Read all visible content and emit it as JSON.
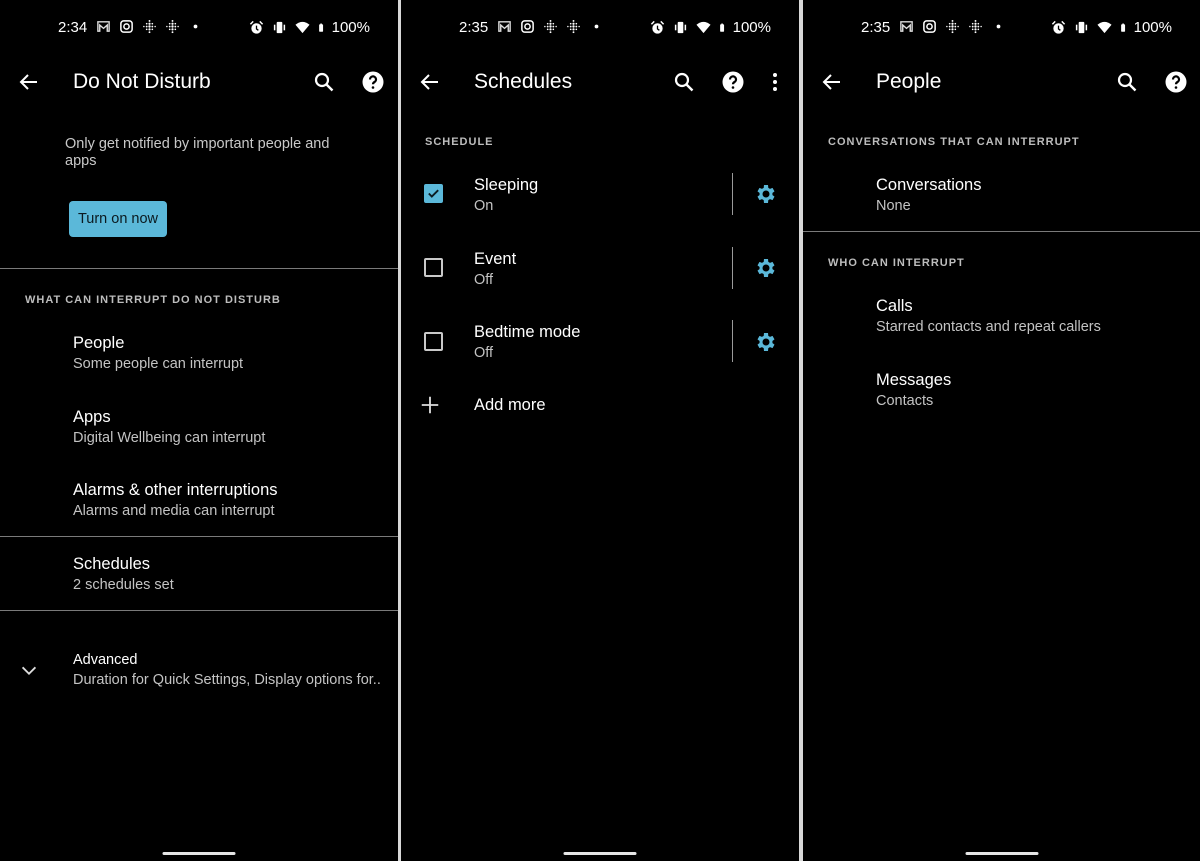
{
  "accent_color": "#5bb8d9",
  "status_bar_common": {
    "battery": "100%",
    "left_icons": [
      "gmail-icon",
      "instagram-icon",
      "fitbit-icon",
      "fitbit-icon",
      "dot-icon"
    ],
    "right_icons": [
      "alarm-icon",
      "vibrate-icon",
      "wifi-icon",
      "battery-icon"
    ]
  },
  "panels": [
    {
      "status_time": "2:34",
      "title": "Do Not Disturb",
      "toolbar_icons": [
        "search-icon",
        "help-icon"
      ],
      "description": "Only get notified by important people and apps",
      "primary_button": "Turn on now",
      "section_header": "WHAT CAN INTERRUPT DO NOT DISTURB",
      "items": [
        {
          "title": "People",
          "subtitle": "Some people can interrupt"
        },
        {
          "title": "Apps",
          "subtitle": "Digital Wellbeing can interrupt"
        },
        {
          "title": "Alarms & other interruptions",
          "subtitle": "Alarms and media can interrupt"
        },
        {
          "title": "Schedules",
          "subtitle": "2 schedules set"
        },
        {
          "title": "Advanced",
          "subtitle": "Duration for Quick Settings, Display options for.."
        }
      ]
    },
    {
      "status_time": "2:35",
      "title": "Schedules",
      "toolbar_icons": [
        "search-icon",
        "help-icon",
        "more-vert-icon"
      ],
      "section_header": "SCHEDULE",
      "schedules": [
        {
          "title": "Sleeping",
          "status": "On",
          "enabled": true
        },
        {
          "title": "Event",
          "status": "Off",
          "enabled": false
        },
        {
          "title": "Bedtime mode",
          "status": "Off",
          "enabled": false
        }
      ],
      "add_more": "Add more"
    },
    {
      "status_time": "2:35",
      "title": "People",
      "toolbar_icons": [
        "search-icon",
        "help-icon"
      ],
      "section1_header": "CONVERSATIONS THAT CAN INTERRUPT",
      "conversations": {
        "title": "Conversations",
        "subtitle": "None"
      },
      "section2_header": "WHO CAN INTERRUPT",
      "items": [
        {
          "title": "Calls",
          "subtitle": "Starred contacts and repeat callers"
        },
        {
          "title": "Messages",
          "subtitle": "Contacts"
        }
      ]
    }
  ]
}
